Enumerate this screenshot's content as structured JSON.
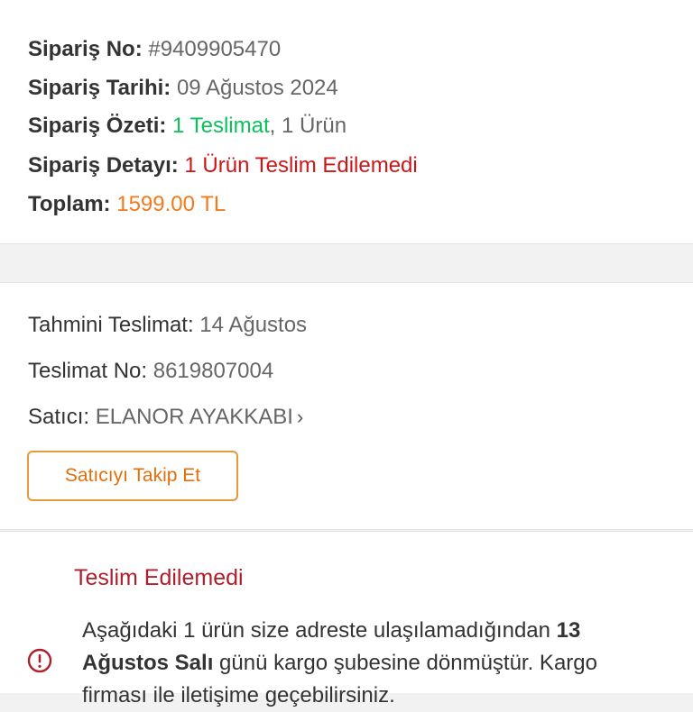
{
  "order": {
    "no_label": "Sipariş No:",
    "no_value": "#9409905470",
    "date_label": "Sipariş Tarihi:",
    "date_value": "09 Ağustos 2024",
    "summary_label": "Sipariş Özeti:",
    "summary_delivery": "1 Teslimat",
    "summary_sep": ", ",
    "summary_items": "1 Ürün",
    "detail_label": "Sipariş Detayı:",
    "detail_value": "1 Ürün Teslim Edilemedi",
    "total_label": "Toplam:",
    "total_value": "1599.00 TL"
  },
  "shipment": {
    "eta_label": "Tahmini Teslimat:",
    "eta_value": "14 Ağustos",
    "no_label": "Teslimat No:",
    "no_value": "8619807004",
    "seller_label": "Satıcı:",
    "seller_value": "ELANOR AYAKKABI",
    "chevron": "›",
    "follow_button": "Satıcıyı Takip Et"
  },
  "status": {
    "title": "Teslim Edilemedi",
    "icon": "info-circle-icon",
    "msg_part1": "Aşağıdaki 1 ürün size adreste ulaşılamadığından ",
    "msg_bold": "13 Ağustos Salı",
    "msg_part2": " günü kargo şubesine dönmüştür. Kargo firması ile iletişime geçebilirsiniz."
  },
  "colors": {
    "green": "#0bc15c",
    "red": "#cc1719",
    "orange": "#f27a1a",
    "status_red": "#b11e2b"
  }
}
